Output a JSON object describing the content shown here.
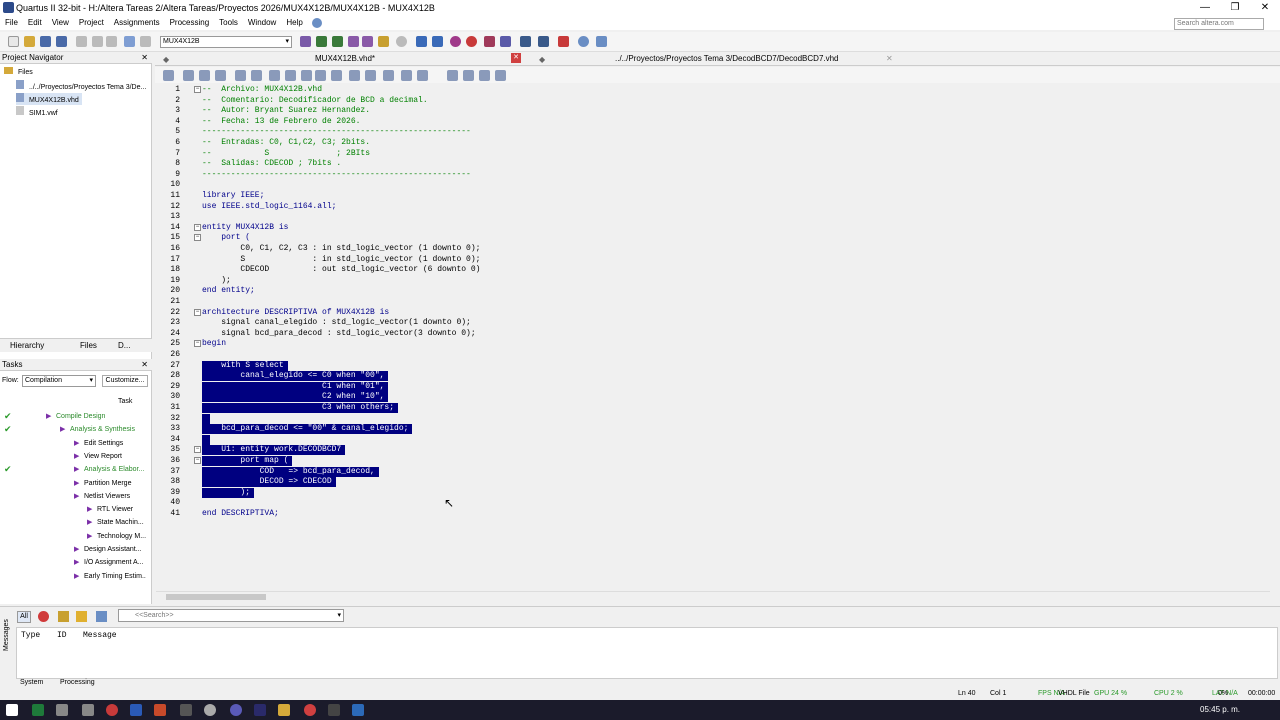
{
  "window": {
    "title": "Quartus II 32-bit - H:/Altera Tareas 2/Altera Tareas/Proyectos 2026/MUX4X12B/MUX4X12B - MUX4X12B",
    "minimize": "—",
    "maximize": "❐",
    "close": "✕"
  },
  "menu": [
    "File",
    "Edit",
    "View",
    "Project",
    "Assignments",
    "Processing",
    "Tools",
    "Window",
    "Help"
  ],
  "search_placeholder": "Search altera.com",
  "revision": "MUX4X12B",
  "project_navigator": {
    "title": "Project Navigator",
    "root": "Files",
    "files": [
      "../../Proyectos/Proyectos Tema 3/De...",
      "MUX4X12B.vhd",
      "SIM1.vwf"
    ],
    "tabs": [
      "Hierarchy",
      "Files",
      "D..."
    ]
  },
  "tasks": {
    "title": "Tasks",
    "flow_label": "Flow:",
    "flow_value": "Compilation",
    "customize": "Customize...",
    "column": "Task",
    "items": [
      {
        "label": "Compile Design",
        "done": true
      },
      {
        "label": "Analysis & Synthesis",
        "done": true
      },
      {
        "label": "Edit Settings",
        "done": false
      },
      {
        "label": "View Report",
        "done": false
      },
      {
        "label": "Analysis & Elabor...",
        "done": true
      },
      {
        "label": "Partition Merge",
        "done": false
      },
      {
        "label": "Netlist Viewers",
        "done": false
      },
      {
        "label": "RTL Viewer",
        "done": false
      },
      {
        "label": "State Machin...",
        "done": false
      },
      {
        "label": "Technology M...",
        "done": false
      },
      {
        "label": "Design Assistant...",
        "done": false
      },
      {
        "label": "I/O Assignment A...",
        "done": false
      },
      {
        "label": "Early Timing Estim...",
        "done": false
      }
    ]
  },
  "editor_tabs": [
    {
      "label": "MUX4X12B.vhd*"
    },
    {
      "label": "../../Proyectos/Proyectos Tema 3/DecodBCD7/DecodBCD7.vhd"
    }
  ],
  "code": [
    {
      "n": "1",
      "text": "--  Archivo: MUX4X12B.vhd",
      "cls": "cmt"
    },
    {
      "n": "2",
      "text": "--  Comentario: Decodificador de BCD a decimal.",
      "cls": "cmt"
    },
    {
      "n": "3",
      "text": "--  Autor: Bryant Suarez Hernandez.",
      "cls": "cmt"
    },
    {
      "n": "4",
      "text": "--  Fecha: 13 de Febrero de 2026.",
      "cls": "cmt"
    },
    {
      "n": "5",
      "text": "--------------------------------------------------------",
      "cls": "cmt"
    },
    {
      "n": "6",
      "text": "--  Entradas: C0, C1,C2, C3; 2bits.",
      "cls": "cmt"
    },
    {
      "n": "7",
      "text": "--           S              ; 2BIts",
      "cls": "cmt"
    },
    {
      "n": "8",
      "text": "--  Salidas: CDECOD ; 7bits .",
      "cls": "cmt"
    },
    {
      "n": "9",
      "text": "--------------------------------------------------------",
      "cls": "cmt"
    },
    {
      "n": "10",
      "text": "",
      "cls": ""
    },
    {
      "n": "11",
      "text": "library IEEE;",
      "cls": "kw"
    },
    {
      "n": "12",
      "text": "use IEEE.std_logic_1164.all;",
      "cls": "kw"
    },
    {
      "n": "13",
      "text": "",
      "cls": ""
    },
    {
      "n": "14",
      "text": "entity MUX4X12B is",
      "cls": "kw"
    },
    {
      "n": "15",
      "text": "    port (",
      "cls": "kw"
    },
    {
      "n": "16",
      "text": "        C0, C1, C2, C3 : in std_logic_vector (1 downto 0);",
      "cls": ""
    },
    {
      "n": "17",
      "text": "        S              : in std_logic_vector (1 downto 0);",
      "cls": ""
    },
    {
      "n": "18",
      "text": "        CDECOD         : out std_logic_vector (6 downto 0)",
      "cls": ""
    },
    {
      "n": "19",
      "text": "    );",
      "cls": ""
    },
    {
      "n": "20",
      "text": "end entity;",
      "cls": "kw"
    },
    {
      "n": "21",
      "text": "",
      "cls": ""
    },
    {
      "n": "22",
      "text": "architecture DESCRIPTIVA of MUX4X12B is",
      "cls": "kw"
    },
    {
      "n": "23",
      "text": "    signal canal_elegido : std_logic_vector(1 downto 0);",
      "cls": ""
    },
    {
      "n": "24",
      "text": "    signal bcd_para_decod : std_logic_vector(3 downto 0);",
      "cls": ""
    },
    {
      "n": "25",
      "text": "begin",
      "cls": "kw"
    },
    {
      "n": "26",
      "text": "",
      "cls": ""
    },
    {
      "n": "27",
      "text": "    with S select",
      "cls": "sel"
    },
    {
      "n": "28",
      "text": "        canal_elegido <= C0 when \"00\",",
      "cls": "sel"
    },
    {
      "n": "29",
      "text": "                         C1 when \"01\",",
      "cls": "sel"
    },
    {
      "n": "30",
      "text": "                         C2 when \"10\",",
      "cls": "sel"
    },
    {
      "n": "31",
      "text": "                         C3 when others;",
      "cls": "sel"
    },
    {
      "n": "32",
      "text": "",
      "cls": "sel"
    },
    {
      "n": "33",
      "text": "    bcd_para_decod <= \"00\" & canal_elegido;",
      "cls": "sel"
    },
    {
      "n": "34",
      "text": "",
      "cls": "sel"
    },
    {
      "n": "35",
      "text": "    U1: entity work.DECODBCD7",
      "cls": "sel"
    },
    {
      "n": "36",
      "text": "        port map (",
      "cls": "sel"
    },
    {
      "n": "37",
      "text": "            COD   => bcd_para_decod,",
      "cls": "sel"
    },
    {
      "n": "38",
      "text": "            DECOD => CDECOD",
      "cls": "sel"
    },
    {
      "n": "39",
      "text": "        );",
      "cls": "sel"
    },
    {
      "n": "40",
      "text": "",
      "cls": ""
    },
    {
      "n": "41",
      "text": "end DESCRIPTIVA;",
      "cls": "kw"
    }
  ],
  "messages": {
    "filter_all": "All",
    "search_placeholder": "<<Search>>",
    "columns": [
      "Type",
      "ID",
      "Message"
    ],
    "tabs": [
      "System",
      "Processing"
    ],
    "side_label": "Messages"
  },
  "status": {
    "ln": "Ln 40",
    "col": "Col 1",
    "file": "VHDL File",
    "fps": "FPS N/A",
    "gpu": "GPU 24 %",
    "cpu": "CPU 2 %",
    "lat": "LAT N/A",
    "pct": "0%",
    "time": "00:00:00"
  },
  "clock": "05:45 p. m."
}
